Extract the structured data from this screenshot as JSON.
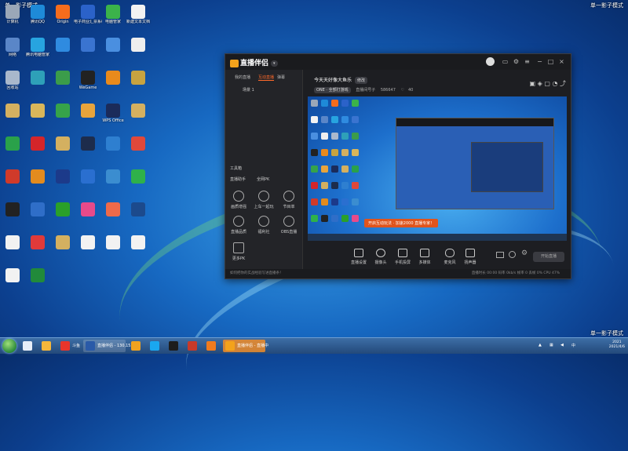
{
  "watermark": "单一影子模式",
  "desktop_icons": [
    {
      "label": "计算机",
      "color": "#9aa7b8"
    },
    {
      "label": "腾讯QQ",
      "color": "#1e8ad8"
    },
    {
      "label": "Origin",
      "color": "#f56c1d"
    },
    {
      "label": "电子商业汇票系统",
      "color": "#2b62c9"
    },
    {
      "label": "电脑管家",
      "color": "#3bb34a"
    },
    {
      "label": "新建文本文档",
      "color": "#f2f2f2"
    },
    {
      "label": "网络",
      "color": "#5a86c8"
    },
    {
      "label": "腾讯电脑管家",
      "color": "#27a4e0"
    },
    {
      "label": "",
      "color": "#2f8be0"
    },
    {
      "label": "",
      "color": "#3a74d0"
    },
    {
      "label": "",
      "color": "#4a8fe0"
    },
    {
      "label": "",
      "color": "#eeeeee"
    },
    {
      "label": "回收站",
      "color": "#a9b8cc"
    },
    {
      "label": "",
      "color": "#2ea0b8"
    },
    {
      "label": "",
      "color": "#3b9c4a"
    },
    {
      "label": "WeGame",
      "color": "#222222"
    },
    {
      "label": "",
      "color": "#e98a1c"
    },
    {
      "label": "",
      "color": "#c7a340"
    },
    {
      "label": "",
      "color": "#d4b060"
    },
    {
      "label": "",
      "color": "#d9b65a"
    },
    {
      "label": "",
      "color": "#36a34a"
    },
    {
      "label": "",
      "color": "#e8a43c"
    },
    {
      "label": "WPS Office",
      "color": "#1b2b5a"
    },
    {
      "label": "",
      "color": "#d4b060"
    },
    {
      "label": "",
      "color": "#2aa14a"
    },
    {
      "label": "",
      "color": "#d4252a"
    },
    {
      "label": "",
      "color": "#d4b060"
    },
    {
      "label": "",
      "color": "#1d2c4c"
    },
    {
      "label": "",
      "color": "#2e7fd0"
    },
    {
      "label": "",
      "color": "#e0483a"
    },
    {
      "label": "",
      "color": "#d03a2a"
    },
    {
      "label": "",
      "color": "#e38b1e"
    },
    {
      "label": "",
      "color": "#1c3a8a"
    },
    {
      "label": "",
      "color": "#2a6fd0"
    },
    {
      "label": "",
      "color": "#3b8dd0"
    },
    {
      "label": "",
      "color": "#2fb14a"
    },
    {
      "label": "",
      "color": "#222222"
    },
    {
      "label": "",
      "color": "#2f6ec8"
    },
    {
      "label": "",
      "color": "#2aa02a"
    },
    {
      "label": "",
      "color": "#e84a8a"
    },
    {
      "label": "",
      "color": "#ee6a4a"
    },
    {
      "label": "",
      "color": "#1c4a8c"
    },
    {
      "label": "",
      "color": "#f2f2f2"
    },
    {
      "label": "",
      "color": "#e03a3a"
    },
    {
      "label": "",
      "color": "#d4b060"
    },
    {
      "label": "",
      "color": "#f2f2f2"
    },
    {
      "label": "",
      "color": "#f2f2f2"
    },
    {
      "label": "",
      "color": "#f2f2f2"
    },
    {
      "label": "",
      "color": "#f2f2f2"
    },
    {
      "label": "",
      "color": "#218a3a"
    }
  ],
  "app": {
    "logo": "直播伴侣",
    "version": "",
    "tabs": [
      "我的直播",
      "互动直播",
      "弹幕"
    ],
    "active_tab": 1,
    "scene_label": "场景 1",
    "tools_header": "工具箱",
    "menu": [
      "直播助手",
      "全网PK"
    ],
    "tools": [
      "画质增强",
      "上车一起玩",
      "节目单",
      "直播品质",
      "福利社",
      "OBS直播"
    ],
    "more_label": "更多PK",
    "room_title": "今天天好像大鱼乐",
    "room_tag": "修改",
    "category": "ONE · 全部打游戏",
    "room_id": "直播间号子",
    "viewers": "586647",
    "likes": "40",
    "tooltip": "开启互动玩法 · 加速2000 直播专家！",
    "controls": [
      "直播设置",
      "摄像头",
      "手机投屏",
      "多媒体",
      "麦克风",
      "扬声器"
    ],
    "go_live": "开始直播",
    "notice": "如何把你的实战经验写进直播条！",
    "stats": "直播时长 00:00  码率 0kb/s  帧率 0  丢帧 0%  CPU 47%"
  },
  "taskbar": {
    "items": [
      {
        "label": "",
        "color": "#e7eef8"
      },
      {
        "label": "",
        "color": "#f5b73b"
      },
      {
        "label": "斗鱼",
        "color": "#e7352b"
      },
      {
        "label": "直播伴侣 - 130,155...",
        "color": "#2a5aa8"
      },
      {
        "label": "",
        "color": "#f0a21f"
      },
      {
        "label": "",
        "color": "#1aa7f0"
      },
      {
        "label": "",
        "color": "#1d1d1d"
      },
      {
        "label": "",
        "color": "#c83a2a"
      },
      {
        "label": "",
        "color": "#f07b1d"
      },
      {
        "label": "直播伴侣 - 直播中",
        "color": "#f3a21b"
      }
    ],
    "clock_time": "2021",
    "clock_date": "2021/4/6"
  }
}
